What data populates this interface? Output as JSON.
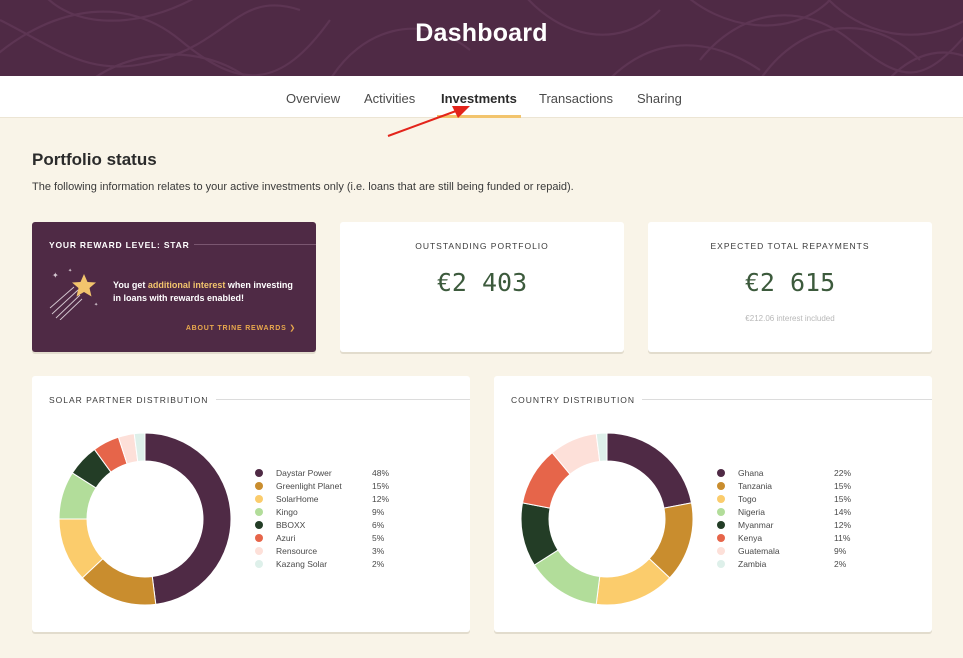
{
  "header": {
    "title": "Dashboard"
  },
  "tabs": [
    {
      "label": "Overview",
      "active": false
    },
    {
      "label": "Activities",
      "active": false
    },
    {
      "label": "Investments",
      "active": true
    },
    {
      "label": "Transactions",
      "active": false
    },
    {
      "label": "Sharing",
      "active": false
    }
  ],
  "portfolio": {
    "title": "Portfolio status",
    "description": "The following information relates to your active investments only (i.e. loans that are still being funded or repaid)."
  },
  "reward": {
    "title": "YOUR REWARD LEVEL: STAR",
    "text_before": "You get ",
    "text_highlight": "additional interest",
    "text_after": " when investing in loans with rewards enabled!",
    "link": "ABOUT TRINE REWARDS ❯",
    "icon": "shooting-star-icon"
  },
  "outstanding": {
    "label": "OUTSTANDING PORTFOLIO",
    "value": "€2 403"
  },
  "expected": {
    "label": "EXPECTED TOTAL REPAYMENTS",
    "value": "€2 615",
    "note": "€212.06 interest included"
  },
  "solar": {
    "title": "SOLAR PARTNER DISTRIBUTION",
    "items": [
      {
        "name": "Daystar Power",
        "pct": "48%",
        "value": 48,
        "color": "#4f2a45"
      },
      {
        "name": "Greenlight Planet",
        "pct": "15%",
        "value": 15,
        "color": "#c98d2e"
      },
      {
        "name": "SolarHome",
        "pct": "12%",
        "value": 12,
        "color": "#fbcc6c"
      },
      {
        "name": "Kingo",
        "pct": "9%",
        "value": 9,
        "color": "#b2dd9a"
      },
      {
        "name": "BBOXX",
        "pct": "6%",
        "value": 6,
        "color": "#233d26"
      },
      {
        "name": "Azuri",
        "pct": "5%",
        "value": 5,
        "color": "#e6654a"
      },
      {
        "name": "Rensource",
        "pct": "3%",
        "value": 3,
        "color": "#fde0d9"
      },
      {
        "name": "Kazang Solar",
        "pct": "2%",
        "value": 2,
        "color": "#def0ea"
      }
    ]
  },
  "country": {
    "title": "COUNTRY DISTRIBUTION",
    "items": [
      {
        "name": "Ghana",
        "pct": "22%",
        "value": 22,
        "color": "#4f2a45"
      },
      {
        "name": "Tanzania",
        "pct": "15%",
        "value": 15,
        "color": "#c98d2e"
      },
      {
        "name": "Togo",
        "pct": "15%",
        "value": 15,
        "color": "#fbcc6c"
      },
      {
        "name": "Nigeria",
        "pct": "14%",
        "value": 14,
        "color": "#b2dd9a"
      },
      {
        "name": "Myanmar",
        "pct": "12%",
        "value": 12,
        "color": "#233d26"
      },
      {
        "name": "Kenya",
        "pct": "11%",
        "value": 11,
        "color": "#e6654a"
      },
      {
        "name": "Guatemala",
        "pct": "9%",
        "value": 9,
        "color": "#fde0d9"
      },
      {
        "name": "Zambia",
        "pct": "2%",
        "value": 2,
        "color": "#def0ea"
      }
    ]
  }
}
